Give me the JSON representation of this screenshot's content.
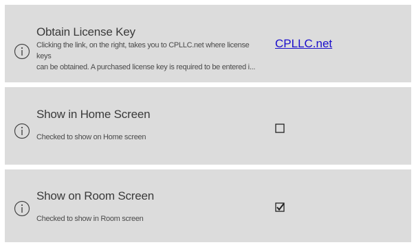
{
  "settings": [
    {
      "title": "Obtain License Key",
      "description": "Clicking the link, on the right, takes you to CPLLC.net where license keys\ncan be obtained.  A purchased license key is required to be entered i...",
      "link_text": "CPLLC.net",
      "icon": "info-icon"
    },
    {
      "title": "Show in Home Screen",
      "description": "Checked to show on Home screen",
      "checked": false,
      "icon": "info-icon"
    },
    {
      "title": "Show on Room Screen",
      "description": "Checked to show in Room screen",
      "checked": true,
      "icon": "info-icon"
    }
  ],
  "colors": {
    "card_background": "#dcdcdc",
    "link": "#1a0dcc",
    "text": "#3a3a3a"
  }
}
